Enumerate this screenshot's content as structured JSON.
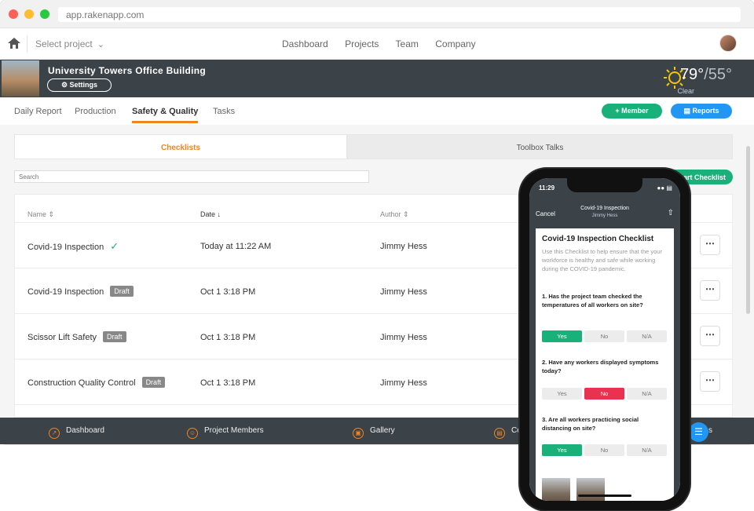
{
  "browser": {
    "url": "app.rakenapp.com"
  },
  "topnav": {
    "project_select": "Select project",
    "items": [
      "Dashboard",
      "Projects",
      "Team",
      "Company"
    ]
  },
  "banner": {
    "project_name": "University Towers Office Building",
    "settings_label": "Settings",
    "weather": {
      "high": "79°",
      "low": "/55°",
      "condition": "Clear"
    }
  },
  "subnav": {
    "tabs": [
      "Daily Report",
      "Production",
      "Safety & Quality",
      "Tasks"
    ],
    "active": "Safety & Quality",
    "member_btn": "Member",
    "reports_btn": "Reports"
  },
  "content": {
    "tabs": [
      "Checklists",
      "Toolbox Talks"
    ],
    "search_placeholder": "Search",
    "start_btn": "Start Checklist",
    "columns": {
      "name": "Name",
      "date": "Date",
      "author": "Author"
    },
    "rows": [
      {
        "name": "Covid-19 Inspection",
        "status": "complete",
        "date": "Today at 11:22 AM",
        "author": "Jimmy Hess"
      },
      {
        "name": "Covid-19 Inspection",
        "status": "Draft",
        "date": "Oct 1 3:18 PM",
        "author": "Jimmy Hess"
      },
      {
        "name": "Scissor Lift Safety",
        "status": "Draft",
        "date": "Oct 1 3:18 PM",
        "author": "Jimmy Hess"
      },
      {
        "name": "Construction Quality Control",
        "status": "Draft",
        "date": "Oct 1 3:18 PM",
        "author": "Jimmy Hess"
      }
    ]
  },
  "bottombar": [
    "Dashboard",
    "Project Members",
    "Gallery",
    "Co",
    "s"
  ],
  "phone": {
    "time": "11:29",
    "cancel": "Cancel",
    "title": "Covid-19 Inspection",
    "subtitle": "Jimmy Hess",
    "card_title": "Covid-19 Inspection Checklist",
    "description": "Use this Checklist to help ensure that the your workforce is healthy and safe while working during the COVID-19 pandemic.",
    "questions": [
      {
        "text": "1. Has the project team checked the temperatures of all workers on site?",
        "answer": "Yes"
      },
      {
        "text": "2. Have any workers displayed symptoms today?",
        "answer": "No"
      },
      {
        "text": "3. Are all workers practicing social distancing on site?",
        "answer": "Yes"
      }
    ],
    "answers": [
      "Yes",
      "No",
      "N/A"
    ]
  },
  "colors": {
    "accent": "#f0841f",
    "green": "#1ab07a",
    "blue": "#2196f3",
    "red": "#e8324f",
    "dark": "#3b4349"
  }
}
